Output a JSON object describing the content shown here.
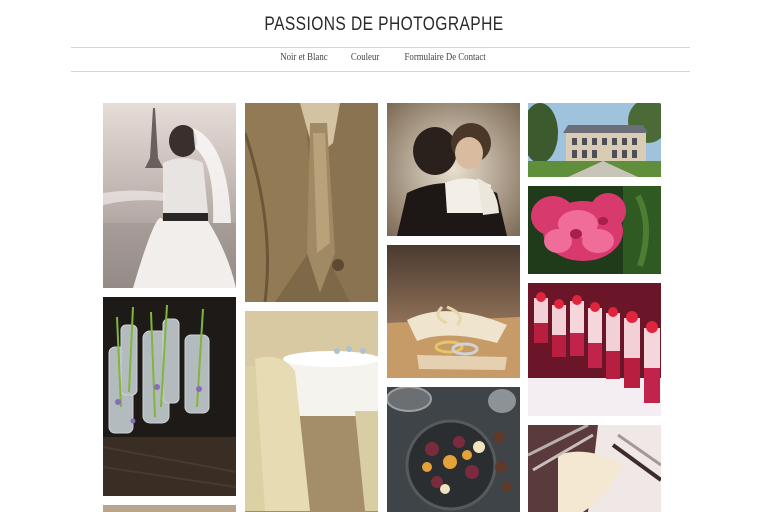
{
  "site": {
    "title": "PASSIONS DE PHOTOGRAPHE"
  },
  "nav": {
    "items": [
      {
        "label": "Noir et Blanc"
      },
      {
        "label": "Couleur"
      },
      {
        "label": "Formulaire De Contact"
      }
    ]
  },
  "gallery": {
    "photos": [
      {
        "subject": "bride-eiffel-tower-icon"
      },
      {
        "subject": "groom-vest-tie-icon"
      },
      {
        "subject": "wedding-couple-icon"
      },
      {
        "subject": "chateau-icon"
      },
      {
        "subject": "pink-flower-icon"
      },
      {
        "subject": "lavender-bottles-icon"
      },
      {
        "subject": "banquet-chairs-icon"
      },
      {
        "subject": "wedding-rings-icon"
      },
      {
        "subject": "verrines-desserts-icon"
      },
      {
        "subject": "fig-platter-icon"
      },
      {
        "subject": "table-setting-icon"
      }
    ]
  },
  "colors": {
    "title": "#2a2a2a",
    "rule": "#d6d6d6",
    "nav": "#444444"
  }
}
